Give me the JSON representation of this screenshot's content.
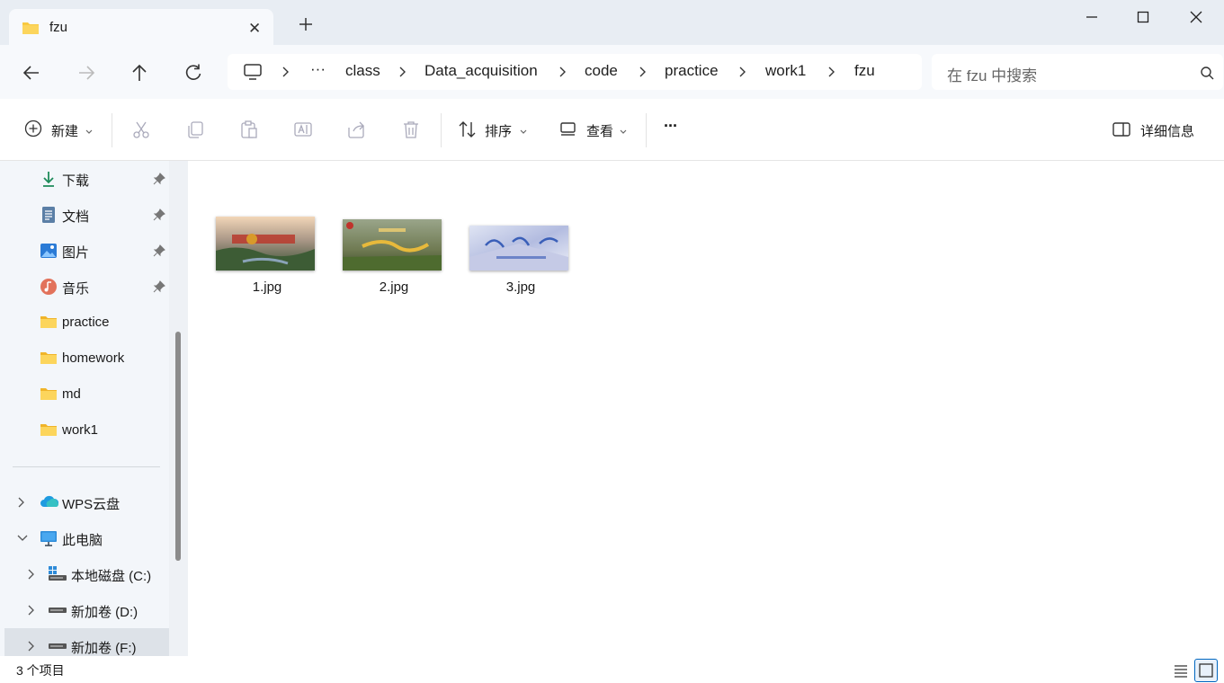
{
  "window": {
    "tab_title": "fzu",
    "tab_close_glyph": "✕",
    "controls": [
      "minimize-icon",
      "maximize-icon",
      "close-icon"
    ]
  },
  "address": {
    "overflow": "···",
    "crumbs": [
      "class",
      "Data_acquisition",
      "code",
      "practice",
      "work1",
      "fzu"
    ]
  },
  "search": {
    "placeholder": "在 fzu 中搜索"
  },
  "toolbar": {
    "new_label": "新建",
    "sort_label": "排序",
    "view_label": "查看",
    "more_label": "···",
    "details_label": "详细信息"
  },
  "sidebar": {
    "items": [
      {
        "label": "下载",
        "icon": "download-icon"
      },
      {
        "label": "文档",
        "icon": "document-icon"
      },
      {
        "label": "图片",
        "icon": "pictures-icon"
      },
      {
        "label": "音乐",
        "icon": "music-icon"
      },
      {
        "label": "practice",
        "icon": "folder-icon"
      },
      {
        "label": "homework",
        "icon": "folder-icon"
      },
      {
        "label": "md",
        "icon": "folder-icon"
      },
      {
        "label": "work1",
        "icon": "folder-icon"
      },
      {
        "label": "WPS云盘",
        "icon": "cloud-icon"
      },
      {
        "label": "此电脑",
        "icon": "computer-icon"
      },
      {
        "label": "本地磁盘 (C:)",
        "icon": "drive-icon"
      },
      {
        "label": "新加卷 (D:)",
        "icon": "drive-icon"
      },
      {
        "label": "新加卷 (F:)",
        "icon": "drive-icon"
      }
    ]
  },
  "files": [
    {
      "name": "1.jpg"
    },
    {
      "name": "2.jpg"
    },
    {
      "name": "3.jpg"
    }
  ],
  "status": {
    "count": "3 个项目"
  },
  "colors": {
    "accent": "#0067c0",
    "folder": "#f8c940"
  }
}
